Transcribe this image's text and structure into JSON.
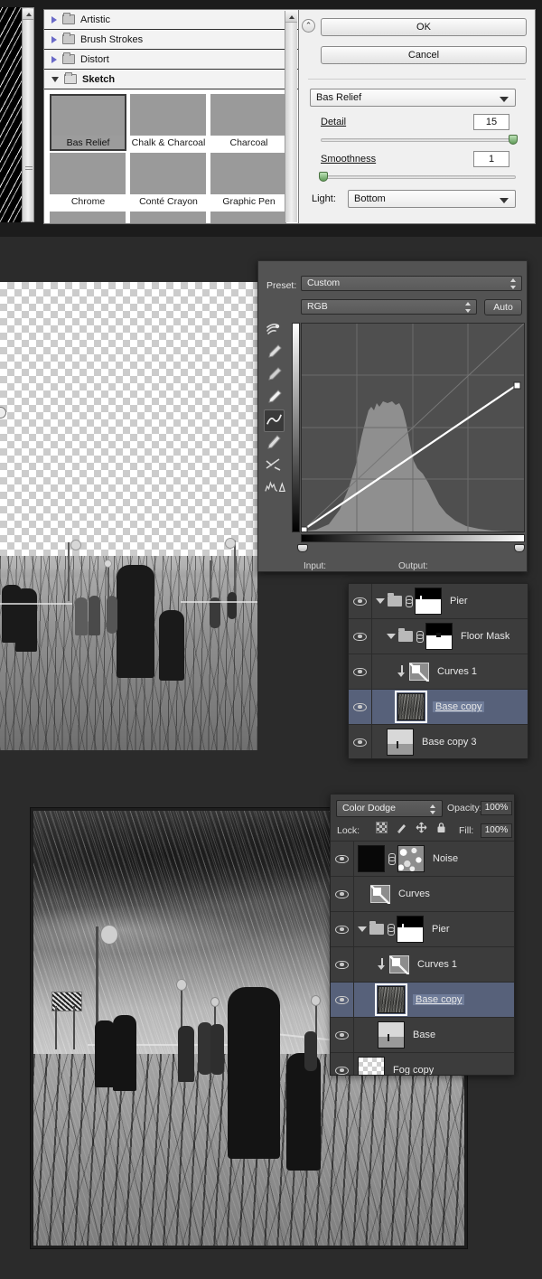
{
  "filter_gallery": {
    "categories": [
      {
        "label": "Artistic",
        "expanded": false
      },
      {
        "label": "Brush Strokes",
        "expanded": false
      },
      {
        "label": "Distort",
        "expanded": false
      },
      {
        "label": "Sketch",
        "expanded": true
      }
    ],
    "filters": [
      {
        "label": "Bas Relief",
        "selected": true
      },
      {
        "label": "Chalk & Charcoal",
        "selected": false
      },
      {
        "label": "Charcoal",
        "selected": false
      },
      {
        "label": "Chrome",
        "selected": false
      },
      {
        "label": "Conté Crayon",
        "selected": false
      },
      {
        "label": "Graphic Pen",
        "selected": false
      }
    ],
    "buttons": {
      "ok": "OK",
      "cancel": "Cancel"
    },
    "active_filter": "Bas Relief",
    "settings": {
      "detail_label": "Detail",
      "detail_value": "15",
      "detail_percent": 100,
      "smoothness_label": "Smoothness",
      "smoothness_value": "1",
      "smoothness_percent": 0,
      "light_label": "Light:",
      "light_value": "Bottom"
    }
  },
  "curves_dialog": {
    "preset_label": "Preset:",
    "preset_value": "Custom",
    "channel_value": "RGB",
    "auto_label": "Auto",
    "input_label": "Input:",
    "output_label": "Output:",
    "tools": [
      "sample-in-image-icon",
      "black-point-eyedropper-icon",
      "gray-point-eyedropper-icon",
      "white-point-eyedropper-icon",
      "curve-point-tool-icon",
      "pencil-draw-tool-icon",
      "smooth-curve-icon",
      "histogram-options-icon"
    ],
    "curve_points": [
      {
        "input": 0,
        "output": 0
      },
      {
        "input": 238,
        "output": 212
      }
    ]
  },
  "layers_panel_1": {
    "rows": [
      {
        "name": "Pier",
        "visible": true,
        "type": "group",
        "selected": false,
        "expanded": true,
        "indent": 0,
        "has_link": true,
        "mask": "pier-mask-thumbnail"
      },
      {
        "name": "Floor Mask",
        "visible": true,
        "type": "group",
        "selected": false,
        "expanded": true,
        "indent": 1,
        "has_link": true,
        "mask": "floor-mask-thumbnail"
      },
      {
        "name": "Curves 1",
        "visible": true,
        "type": "adjustment",
        "selected": false,
        "indent": 1,
        "clipped": true
      },
      {
        "name": "Base copy",
        "visible": true,
        "type": "pixel",
        "selected": true,
        "indent": 1,
        "editing": true
      },
      {
        "name": "Base copy 3",
        "visible": true,
        "type": "pixel",
        "selected": false,
        "indent": 0
      }
    ]
  },
  "layers_panel_2": {
    "blend_mode": "Color Dodge",
    "opacity_label": "Opacity:",
    "opacity_value": "100%",
    "lock_label": "Lock:",
    "lock_icons": [
      "lock-transparent-pixels-icon",
      "lock-image-pixels-icon",
      "lock-position-icon",
      "lock-all-icon"
    ],
    "fill_label": "Fill:",
    "fill_value": "100%",
    "rows": [
      {
        "name": "Noise",
        "visible": true,
        "type": "pixel-masked",
        "selected": false,
        "indent": 0,
        "has_link": true
      },
      {
        "name": "Curves",
        "visible": true,
        "type": "adjustment",
        "selected": false,
        "indent": 0
      },
      {
        "name": "Pier",
        "visible": true,
        "type": "group",
        "selected": false,
        "indent": 0,
        "expanded": true,
        "has_link": true,
        "mask": "pier-mask-thumbnail"
      },
      {
        "name": "Curves 1",
        "visible": true,
        "type": "adjustment",
        "selected": false,
        "indent": 1,
        "clipped": true
      },
      {
        "name": "Base copy",
        "visible": true,
        "type": "pixel",
        "selected": true,
        "indent": 1,
        "editing": true
      },
      {
        "name": "Base",
        "visible": true,
        "type": "pixel",
        "selected": false,
        "indent": 1
      },
      {
        "name": "Fog copy",
        "visible": true,
        "type": "pixel",
        "selected": false,
        "indent": 0
      }
    ]
  },
  "colors": {
    "panel_bg": "#3c3c3c",
    "dialog_bg": "#535353",
    "selection_blue": "#57617a",
    "app_bg": "#2b2b2b",
    "slider_green": "#5f9b58"
  }
}
